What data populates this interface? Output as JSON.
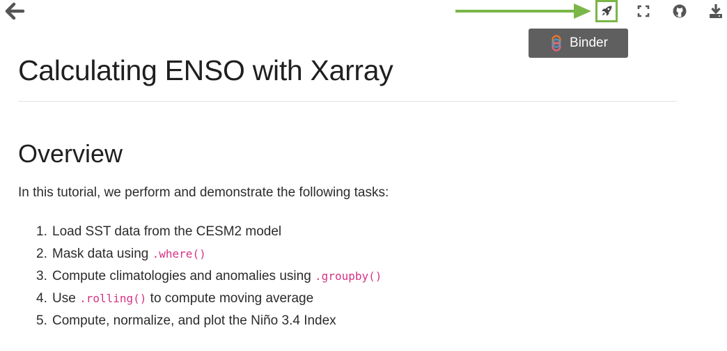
{
  "toolbar": {
    "back_icon": "arrow-left-icon",
    "launch_icon": "rocket-icon",
    "fullscreen_icon": "fullscreen-icon",
    "github_icon": "github-icon",
    "download_icon": "download-icon",
    "highlight_color": "#7ab648",
    "tooltip": {
      "icon": "binder-logo-icon",
      "label": "Binder"
    }
  },
  "page": {
    "title": "Calculating ENSO with Xarray",
    "section_heading": "Overview",
    "intro": "In this tutorial, we perform and demonstrate the following tasks:",
    "tasks": [
      {
        "num": "1.",
        "before": "Load SST data from the CESM2 model",
        "code": "",
        "after": ""
      },
      {
        "num": "2.",
        "before": "Mask data using ",
        "code": ".where()",
        "after": ""
      },
      {
        "num": "3.",
        "before": "Compute climatologies and anomalies using ",
        "code": ".groupby()",
        "after": ""
      },
      {
        "num": "4.",
        "before": "Use ",
        "code": ".rolling()",
        "after": " to compute moving average"
      },
      {
        "num": "5.",
        "before": "Compute, normalize, and plot the Niño 3.4 Index",
        "code": "",
        "after": ""
      }
    ]
  },
  "colors": {
    "code": "#d63384",
    "tooltip_bg": "#5f5f5f",
    "icon": "#555555"
  }
}
